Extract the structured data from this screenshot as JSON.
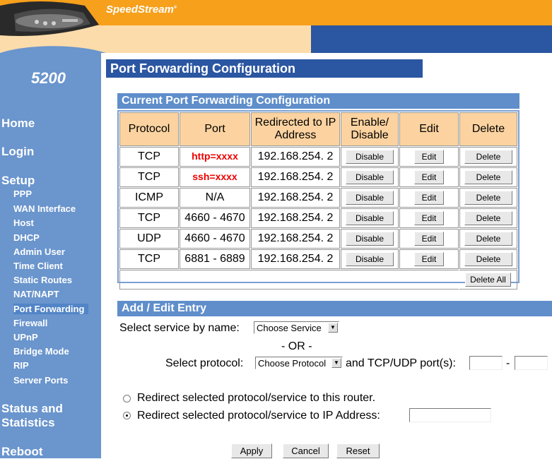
{
  "header": {
    "brand": "SpeedStream",
    "brand_mark": "®",
    "model": "5200"
  },
  "nav": {
    "home": "Home",
    "login": "Login",
    "setup": "Setup",
    "setup_items": [
      "PPP",
      "WAN Interface",
      "Host",
      "DHCP",
      "Admin User",
      "Time Client",
      "Static Routes",
      "NAT/NAPT",
      "Port Forwarding",
      "Firewall",
      "UPnP",
      "Bridge Mode",
      "RIP",
      "Server Ports"
    ],
    "status_line1": "Status and",
    "status_line2": "Statistics",
    "reboot": "Reboot"
  },
  "page_title": "Port Forwarding Configuration",
  "current": {
    "heading": "Current Port Forwarding Configuration",
    "columns": [
      "Protocol",
      "Port",
      "Redirected to IP Address",
      "Enable/ Disable",
      "Edit",
      "Delete"
    ],
    "rows": [
      {
        "protocol": "TCP",
        "port": "http=xxxx",
        "ip": "192.168.254. 2",
        "toggle": "Disable",
        "edit": "Edit",
        "delete": "Delete"
      },
      {
        "protocol": "TCP",
        "port": "ssh=xxxx",
        "ip": "192.168.254. 2",
        "toggle": "Disable",
        "edit": "Edit",
        "delete": "Delete"
      },
      {
        "protocol": "ICMP",
        "port": "N/A",
        "ip": "192.168.254. 2",
        "toggle": "Disable",
        "edit": "Edit",
        "delete": "Delete"
      },
      {
        "protocol": "TCP",
        "port": "4660 - 4670",
        "ip": "192.168.254. 2",
        "toggle": "Disable",
        "edit": "Edit",
        "delete": "Delete"
      },
      {
        "protocol": "UDP",
        "port": "4660 - 4670",
        "ip": "192.168.254. 2",
        "toggle": "Disable",
        "edit": "Edit",
        "delete": "Delete"
      },
      {
        "protocol": "TCP",
        "port": "6881 - 6889",
        "ip": "192.168.254. 2",
        "toggle": "Disable",
        "edit": "Edit",
        "delete": "Delete"
      }
    ],
    "delete_all": "Delete All"
  },
  "edit": {
    "heading": "Add / Edit Entry",
    "service_label": "Select service by name:",
    "service_value": "Choose Service",
    "or_text": "- OR -",
    "protocol_label": "Select protocol:",
    "protocol_value": "Choose Protocol",
    "ports_label": "and TCP/UDP port(s):",
    "dash": "-",
    "radio_router": "Redirect selected protocol/service to this router.",
    "radio_ip": "Redirect selected protocol/service to IP Address:",
    "radio_selected": "ip",
    "apply": "Apply",
    "cancel": "Cancel",
    "reset": "Reset"
  },
  "colors": {
    "orange": "#f6a01c",
    "navy": "#2b56a1",
    "nav_blue": "#6a95cd",
    "section_blue": "#5f8ecb",
    "table_header": "#fcd3a0",
    "port_red": "#ee0000"
  }
}
